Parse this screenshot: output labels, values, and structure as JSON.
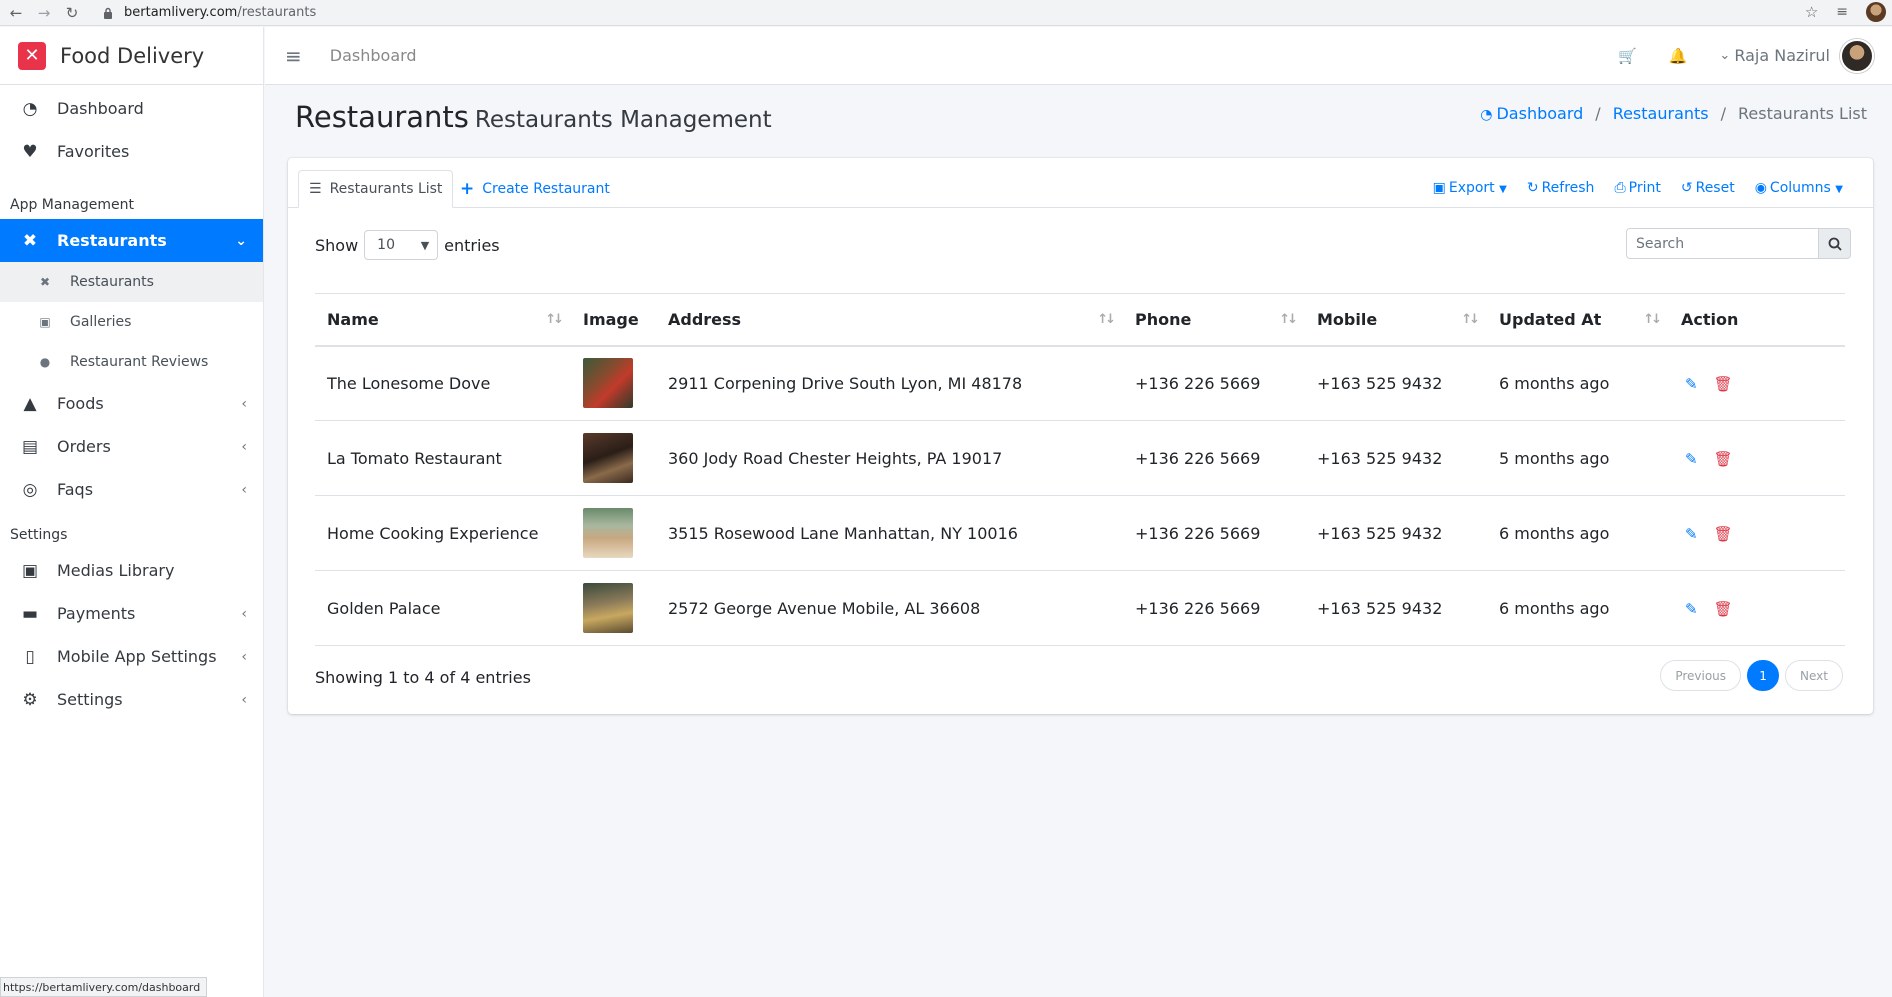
{
  "browser": {
    "url_host": "bertamlivery.com",
    "url_path": "/restaurants",
    "status_url": "https://bertamlivery.com/dashboard"
  },
  "brand": {
    "name": "Food Delivery"
  },
  "sidebar": {
    "top_items": [
      {
        "label": "Dashboard",
        "icon": "dashboard-icon"
      },
      {
        "label": "Favorites",
        "icon": "heart-icon"
      }
    ],
    "app_management_header": "App Management",
    "restaurants": {
      "label": "Restaurants",
      "icon": "utensils-icon"
    },
    "sub_items": [
      {
        "label": "Restaurants",
        "icon": "utensils-icon"
      },
      {
        "label": "Galleries",
        "icon": "image-icon"
      },
      {
        "label": "Restaurant Reviews",
        "icon": "comments-icon"
      }
    ],
    "app_items": [
      {
        "label": "Foods",
        "icon": "fire-icon"
      },
      {
        "label": "Orders",
        "icon": "archive-icon"
      },
      {
        "label": "Faqs",
        "icon": "life-ring-icon"
      }
    ],
    "settings_header": "Settings",
    "settings_items": [
      {
        "label": "Medias Library",
        "icon": "images-icon"
      },
      {
        "label": "Payments",
        "icon": "credit-card-icon"
      },
      {
        "label": "Mobile App Settings",
        "icon": "mobile-icon"
      },
      {
        "label": "Settings",
        "icon": "cogs-icon"
      }
    ]
  },
  "topbar": {
    "link": "Dashboard",
    "user_name": "Raja Nazirul"
  },
  "header": {
    "title": "Restaurants",
    "subtitle": "Restaurants Management",
    "breadcrumb": [
      "Dashboard",
      "Restaurants",
      "Restaurants List"
    ]
  },
  "card": {
    "tab_active": "Restaurants List",
    "tab_create": "Create Restaurant",
    "tools": [
      "Export",
      "Refresh",
      "Print",
      "Reset",
      "Columns"
    ],
    "show_label": "Show",
    "entries_label": "entries",
    "page_length": "10",
    "search_placeholder": "Search",
    "info": "Showing 1 to 4 of 4 entries",
    "pager": {
      "prev": "Previous",
      "current": "1",
      "next": "Next"
    }
  },
  "table": {
    "columns": [
      "Name",
      "Image",
      "Address",
      "Phone",
      "Mobile",
      "Updated At",
      "Action"
    ],
    "rows": [
      {
        "name": "The Lonesome Dove",
        "address": "2911 Corpening Drive South Lyon, MI 48178",
        "phone": "+136 226 5669",
        "mobile": "+163 525 9432",
        "updated": "6 months ago"
      },
      {
        "name": "La Tomato Restaurant",
        "address": "360 Jody Road Chester Heights, PA 19017",
        "phone": "+136 226 5669",
        "mobile": "+163 525 9432",
        "updated": "5 months ago"
      },
      {
        "name": "Home Cooking Experience",
        "address": "3515 Rosewood Lane Manhattan, NY 10016",
        "phone": "+136 226 5669",
        "mobile": "+163 525 9432",
        "updated": "6 months ago"
      },
      {
        "name": "Golden Palace",
        "address": "2572 George Avenue Mobile, AL 36608",
        "phone": "+136 226 5669",
        "mobile": "+163 525 9432",
        "updated": "6 months ago"
      }
    ]
  },
  "colors": {
    "primary": "#007bff",
    "brand": "#e8334a",
    "danger": "#dc3545"
  }
}
